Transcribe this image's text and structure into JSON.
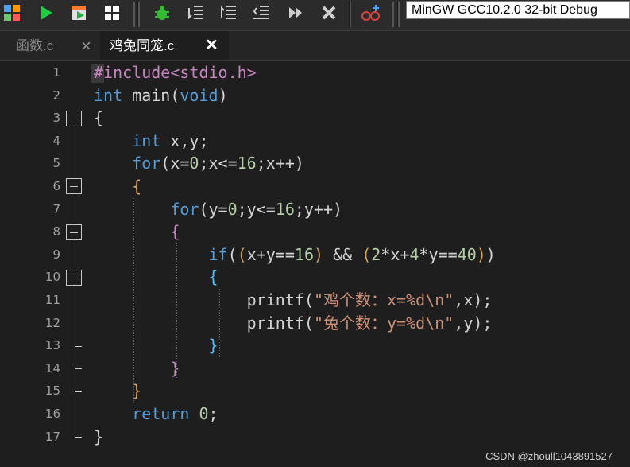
{
  "toolbar": {
    "compiler": "MinGW GCC10.2.0 32-bit Debug",
    "icons": [
      "grid-icon",
      "run-icon",
      "compile-run-icon",
      "grid-small-icon",
      "debug-icon",
      "indent-icon",
      "unindent-icon",
      "format-icon",
      "step-icon",
      "stop-icon",
      "glasses-icon"
    ]
  },
  "tabs": [
    {
      "label": "函数.c",
      "close": "×"
    },
    {
      "label": "鸡兔同笼.c",
      "close": "✕"
    }
  ],
  "colors": {
    "keyword": "#569cd6",
    "preproc": "#c586c0",
    "string": "#ce9178",
    "number": "#b5cea8",
    "text": "#d4d4d4",
    "bracket1": "#d7a35a",
    "bracket2": "#c586c0",
    "bracket3": "#4fc1ff"
  },
  "code": {
    "line_numbers": [
      "1",
      "2",
      "3",
      "4",
      "5",
      "6",
      "7",
      "8",
      "9",
      "10",
      "11",
      "12",
      "13",
      "14",
      "15",
      "16",
      "17"
    ],
    "lines": [
      [
        {
          "t": "#include<stdio.h>",
          "c": "#c586c0"
        }
      ],
      [
        {
          "t": "int",
          "c": "#569cd6"
        },
        {
          "t": " main",
          "c": "#d4d4d4"
        },
        {
          "t": "(",
          "c": "#d4d4d4"
        },
        {
          "t": "void",
          "c": "#569cd6"
        },
        {
          "t": ")",
          "c": "#d4d4d4"
        }
      ],
      [
        {
          "t": "{",
          "c": "#d4d4d4"
        }
      ],
      [
        {
          "t": "    ",
          "c": "#d4d4d4"
        },
        {
          "t": "int",
          "c": "#569cd6"
        },
        {
          "t": " x,y;",
          "c": "#d4d4d4"
        }
      ],
      [
        {
          "t": "    ",
          "c": "#d4d4d4"
        },
        {
          "t": "for",
          "c": "#569cd6"
        },
        {
          "t": "(x=",
          "c": "#d4d4d4"
        },
        {
          "t": "0",
          "c": "#b5cea8"
        },
        {
          "t": ";x<=",
          "c": "#d4d4d4"
        },
        {
          "t": "16",
          "c": "#b5cea8"
        },
        {
          "t": ";x++)",
          "c": "#d4d4d4"
        }
      ],
      [
        {
          "t": "    ",
          "c": "#d4d4d4"
        },
        {
          "t": "{",
          "c": "#d7a35a"
        }
      ],
      [
        {
          "t": "        ",
          "c": "#d4d4d4"
        },
        {
          "t": "for",
          "c": "#569cd6"
        },
        {
          "t": "(y=",
          "c": "#d4d4d4"
        },
        {
          "t": "0",
          "c": "#b5cea8"
        },
        {
          "t": ";y<=",
          "c": "#d4d4d4"
        },
        {
          "t": "16",
          "c": "#b5cea8"
        },
        {
          "t": ";y++)",
          "c": "#d4d4d4"
        }
      ],
      [
        {
          "t": "        ",
          "c": "#d4d4d4"
        },
        {
          "t": "{",
          "c": "#c586c0"
        }
      ],
      [
        {
          "t": "            ",
          "c": "#d4d4d4"
        },
        {
          "t": "if",
          "c": "#569cd6"
        },
        {
          "t": "(",
          "c": "#d4d4d4"
        },
        {
          "t": "(",
          "c": "#d7a35a"
        },
        {
          "t": "x+y==",
          "c": "#d4d4d4"
        },
        {
          "t": "16",
          "c": "#b5cea8"
        },
        {
          "t": ")",
          "c": "#d7a35a"
        },
        {
          "t": " && ",
          "c": "#d4d4d4"
        },
        {
          "t": "(",
          "c": "#d7a35a"
        },
        {
          "t": "2",
          "c": "#b5cea8"
        },
        {
          "t": "*x+",
          "c": "#d4d4d4"
        },
        {
          "t": "4",
          "c": "#b5cea8"
        },
        {
          "t": "*y==",
          "c": "#d4d4d4"
        },
        {
          "t": "40",
          "c": "#b5cea8"
        },
        {
          "t": ")",
          "c": "#d7a35a"
        },
        {
          "t": ")",
          "c": "#d4d4d4"
        }
      ],
      [
        {
          "t": "            ",
          "c": "#d4d4d4"
        },
        {
          "t": "{",
          "c": "#4fc1ff"
        }
      ],
      [
        {
          "t": "                ",
          "c": "#d4d4d4"
        },
        {
          "t": "printf",
          "c": "#d4d4d4"
        },
        {
          "t": "(",
          "c": "#d4d4d4"
        },
        {
          "t": "\"鸡个数：x=%d\\n\"",
          "c": "#ce9178"
        },
        {
          "t": ",x);",
          "c": "#d4d4d4"
        }
      ],
      [
        {
          "t": "                ",
          "c": "#d4d4d4"
        },
        {
          "t": "printf",
          "c": "#d4d4d4"
        },
        {
          "t": "(",
          "c": "#d4d4d4"
        },
        {
          "t": "\"兔个数：y=%d\\n\"",
          "c": "#ce9178"
        },
        {
          "t": ",y);",
          "c": "#d4d4d4"
        }
      ],
      [
        {
          "t": "            ",
          "c": "#d4d4d4"
        },
        {
          "t": "}",
          "c": "#4fc1ff"
        }
      ],
      [
        {
          "t": "        ",
          "c": "#d4d4d4"
        },
        {
          "t": "}",
          "c": "#c586c0"
        }
      ],
      [
        {
          "t": "    ",
          "c": "#d4d4d4"
        },
        {
          "t": "}",
          "c": "#d7a35a"
        }
      ],
      [
        {
          "t": "    ",
          "c": "#d4d4d4"
        },
        {
          "t": "return",
          "c": "#569cd6"
        },
        {
          "t": " ",
          "c": "#d4d4d4"
        },
        {
          "t": "0",
          "c": "#b5cea8"
        },
        {
          "t": ";",
          "c": "#d4d4d4"
        }
      ],
      [
        {
          "t": "}",
          "c": "#d4d4d4"
        }
      ]
    ]
  },
  "watermark": "CSDN @zhoull1043891527"
}
